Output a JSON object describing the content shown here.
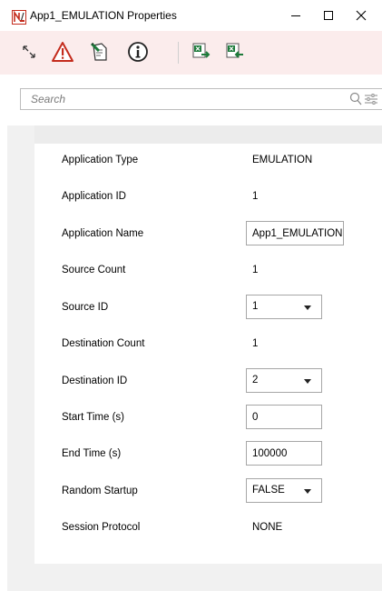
{
  "window": {
    "title": "App1_EMULATION Properties"
  },
  "toolbar": {
    "icons": [
      "expand-icon",
      "warning-icon",
      "edit-document-icon",
      "info-icon",
      "excel-export-icon",
      "excel-import-icon"
    ]
  },
  "search": {
    "placeholder": "Search"
  },
  "colors": {
    "toolbar_bg": "#fbecec",
    "warning_red": "#c42b1c",
    "excel_green": "#1d7a3a"
  },
  "properties": [
    {
      "label": "Application Type",
      "value": "EMULATION",
      "control": "text"
    },
    {
      "label": "Application ID",
      "value": "1",
      "control": "text"
    },
    {
      "label": "Application Name",
      "value": "App1_EMULATION",
      "control": "input"
    },
    {
      "label": "Source Count",
      "value": "1",
      "control": "text"
    },
    {
      "label": "Source ID",
      "value": "1",
      "control": "select"
    },
    {
      "label": "Destination Count",
      "value": "1",
      "control": "text"
    },
    {
      "label": "Destination ID",
      "value": "2",
      "control": "select"
    },
    {
      "label": "Start Time (s)",
      "value": "0",
      "control": "input"
    },
    {
      "label": "End Time (s)",
      "value": "100000",
      "control": "input"
    },
    {
      "label": "Random Startup",
      "value": "FALSE",
      "control": "select"
    },
    {
      "label": "Session Protocol",
      "value": "NONE",
      "control": "text"
    }
  ]
}
